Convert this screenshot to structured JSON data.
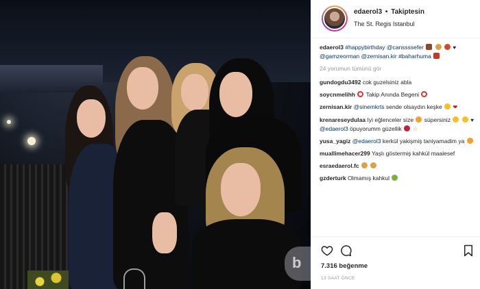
{
  "header": {
    "username": "edaerol3",
    "separator": "•",
    "follow_label": "Takiptesin",
    "location": "The St. Regis Istanbul"
  },
  "caption": {
    "username": "edaerol3",
    "text_1": "#happybirthday @canssssefer",
    "text_2": "@gamzeorman @zernisan.kir",
    "text_3": "#baharhuma"
  },
  "view_all_comments": "24 yorumun tümünü gör",
  "comments": [
    {
      "user": "gundogdu3492",
      "text": "cok guzelsiniz abla"
    },
    {
      "user": "soycnmelihh",
      "text": "Takip Anında Begeni"
    },
    {
      "user": "zernisan.kir",
      "mention": "@sinemkrts",
      "text": "sende olsaydın keşke"
    },
    {
      "user": "krenareseydulaa",
      "text_a": "Iyi eğlenceler size",
      "text_b": "süpersiniz",
      "mention": "@edaerol3",
      "text_c": "öpuyorumm güzellik"
    },
    {
      "user": "yusa_yagiz",
      "mention": "@edaerol3",
      "text": "kerkül yakişmiş taniyamadim ya"
    },
    {
      "user": "muallimehacer299",
      "text": "Yaşlı göstermiş kahkül maalesef"
    },
    {
      "user": "esraedaerol.fc",
      "text": ""
    },
    {
      "user": "gzderturk",
      "text": "Olmamış kahkul"
    }
  ],
  "actions": {
    "likes": "7.316 beğenme",
    "time": "13 SAAT ÖNCE"
  },
  "photo": {
    "watermark_letter": "b"
  },
  "icons": {
    "like": "heart-icon",
    "comment": "comment-icon",
    "save": "bookmark-icon"
  },
  "colors": {
    "link": "#003569",
    "muted": "#999999",
    "border": "#efefef"
  }
}
